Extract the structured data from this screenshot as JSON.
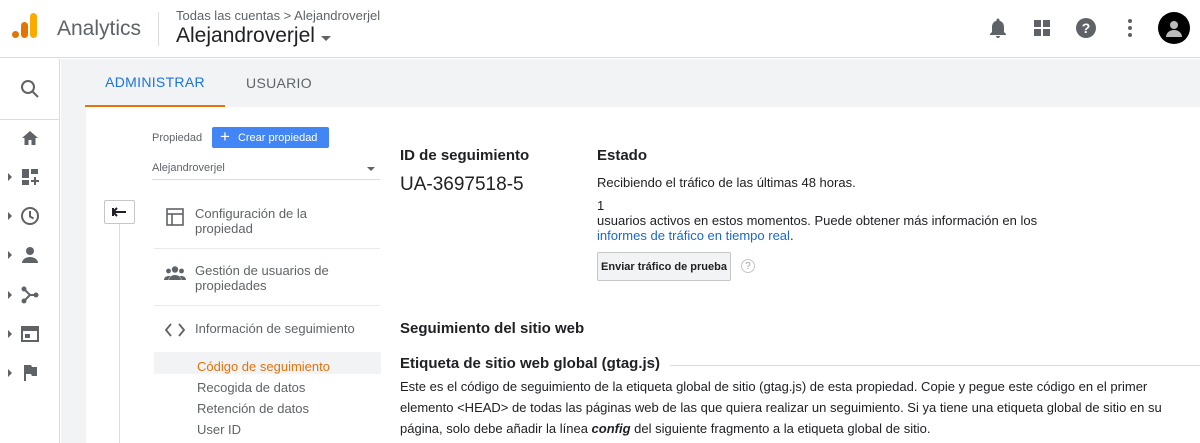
{
  "header": {
    "app_title": "Analytics",
    "breadcrumb": "Todas las cuentas > Alejandroverjel",
    "account_name": "Alejandroverjel",
    "icons": [
      "bell-icon",
      "apps-grid-icon",
      "help-icon",
      "more-vert-icon"
    ]
  },
  "rail": {
    "icons": [
      "search-icon",
      "home-icon",
      "customization-icon",
      "realtime-clock-icon",
      "audience-person-icon",
      "acquisition-icon",
      "behavior-icon",
      "conversions-flag-icon"
    ]
  },
  "tabs": [
    {
      "label": "ADMINISTRAR",
      "active": true
    },
    {
      "label": "USUARIO",
      "active": false
    }
  ],
  "property": {
    "label": "Propiedad",
    "create_button": "Crear propiedad",
    "selected": "Alejandroverjel"
  },
  "menu": {
    "item1": "Configuración de la propiedad",
    "item2": "Gestión de usuarios de propiedades",
    "item3": "Información de seguimiento",
    "sub": [
      "Código de seguimiento",
      "Recogida de datos",
      "Retención de datos",
      "User ID"
    ]
  },
  "main": {
    "id_heading": "ID de seguimiento",
    "tracking_id": "UA-3697518-5",
    "status_heading": "Estado",
    "status_text": "Recibiendo el tráfico de las últimas 48 horas.",
    "active_users": "1",
    "users_text": "usuarios activos en estos momentos. Puede obtener más información en los",
    "realtime_link": "informes de tráfico en tiempo real",
    "realtime_suffix": ".",
    "send_button": "Enviar tráfico de prueba",
    "help_mark": "?",
    "site_heading": "Seguimiento del sitio web",
    "gtag_heading": "Etiqueta de sitio web global (gtag.js)",
    "desc_part1": "Este es el código de seguimiento de la etiqueta global de sitio (gtag.js) de esta propiedad. Copie y pegue este código en el primer elemento <HEAD> de todas las páginas web de las que quiera realizar un seguimiento. Si ya tiene una etiqueta global de sitio en su página, solo debe añadir la línea ",
    "desc_config": "config",
    "desc_part2": " del siguiente fragmento a la etiqueta global de sitio."
  },
  "colors": {
    "accent_blue": "#1a73e8",
    "accent_orange": "#e8710a",
    "button_blue": "#4285f4"
  }
}
